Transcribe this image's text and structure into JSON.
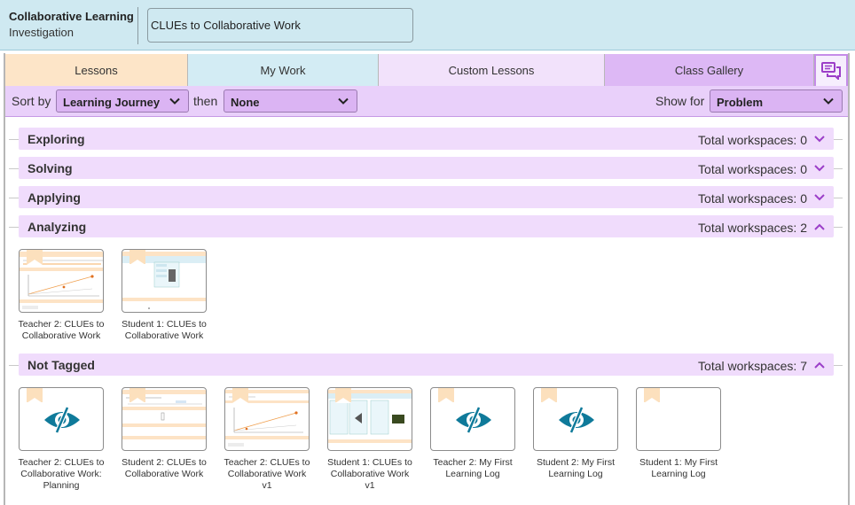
{
  "header": {
    "title": "Collaborative Learning",
    "subtitle": "Investigation",
    "document_title": "CLUEs to Collaborative Work"
  },
  "tabs": [
    {
      "label": "Lessons"
    },
    {
      "label": "My Work"
    },
    {
      "label": "Custom Lessons"
    },
    {
      "label": "Class Gallery"
    }
  ],
  "sortbar": {
    "sort_label": "Sort by",
    "sort_value": "Learning Journey",
    "then_label": "then",
    "then_value": "None",
    "show_label": "Show for",
    "show_value": "Problem"
  },
  "sections": [
    {
      "name": "Exploring",
      "total": "Total workspaces: 0",
      "expanded": false
    },
    {
      "name": "Solving",
      "total": "Total workspaces: 0",
      "expanded": false
    },
    {
      "name": "Applying",
      "total": "Total workspaces: 0",
      "expanded": false
    },
    {
      "name": "Analyzing",
      "total": "Total workspaces: 2",
      "expanded": true,
      "items": [
        {
          "label": "Teacher 2: CLUEs to Collaborative Work",
          "preview": "graph"
        },
        {
          "label": "Student 1: CLUEs to Collaborative Work",
          "preview": "table"
        }
      ]
    },
    {
      "name": "Not Tagged",
      "total": "Total workspaces: 7",
      "expanded": true,
      "items": [
        {
          "label": "Teacher 2: CLUEs to Collaborative Work: Planning",
          "preview": "hidden"
        },
        {
          "label": "Student 2: CLUEs to Collaborative Work",
          "preview": "doc"
        },
        {
          "label": "Teacher 2: CLUEs to Collaborative Work v1",
          "preview": "graph"
        },
        {
          "label": "Student 1: CLUEs to Collaborative Work v1",
          "preview": "table"
        },
        {
          "label": "Teacher 2: My First Learning Log",
          "preview": "hidden"
        },
        {
          "label": "Student 2: My First Learning Log",
          "preview": "hidden"
        },
        {
          "label": "Student 1: My First Learning Log",
          "preview": "blank"
        }
      ]
    }
  ],
  "colors": {
    "header_bg": "#cfe9f1",
    "lessons_tab": "#fde5c8",
    "mywork_tab": "#d3ecf4",
    "custom_tab": "#f2e2fb",
    "gallery_tab": "#ddb8f5",
    "section_bar": "#f0dcfc",
    "accent_purple": "#9b3ec8",
    "hidden_icon": "#0f7a9a"
  },
  "icons": {
    "chat": "chat-bubbles-icon",
    "hidden": "eye-slash-icon",
    "collapse": "chevron-up-icon",
    "expand": "chevron-down-icon"
  }
}
